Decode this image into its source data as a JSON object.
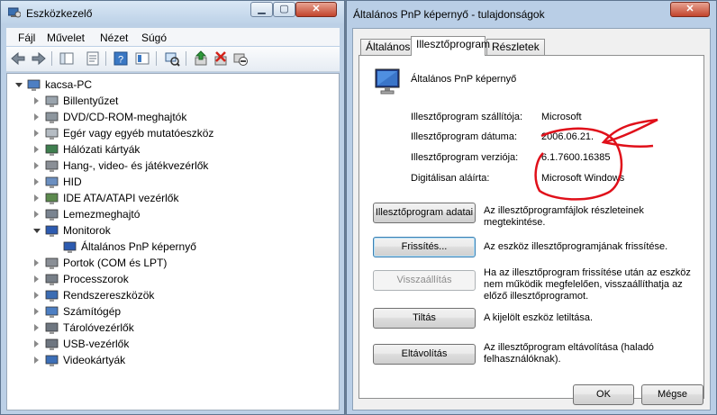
{
  "device_manager": {
    "title": "Eszközkezelő",
    "menu": [
      "Fájl",
      "Művelet",
      "Nézet",
      "Súgó"
    ],
    "toolbar_icons": [
      "back-arrow-icon",
      "forward-arrow-icon",
      "show-hide-console-tree-icon",
      "properties-icon",
      "help-icon",
      "view-icon",
      "scan-hardware-changes-icon",
      "update-driver-icon",
      "uninstall-icon",
      "disable-icon"
    ],
    "tree": [
      {
        "label": "kacsa-PC",
        "level": 0,
        "icon": "computer-icon",
        "expanded": true
      },
      {
        "label": "Billentyűzet",
        "level": 1,
        "icon": "keyboard-icon"
      },
      {
        "label": "DVD/CD-ROM-meghajtók",
        "level": 1,
        "icon": "dvd-drive-icon"
      },
      {
        "label": "Egér vagy egyéb mutatóeszköz",
        "level": 1,
        "icon": "mouse-icon"
      },
      {
        "label": "Hálózati kártyák",
        "level": 1,
        "icon": "network-card-icon"
      },
      {
        "label": "Hang-, video- és játékvezérlők",
        "level": 1,
        "icon": "speaker-icon"
      },
      {
        "label": "HID",
        "level": 1,
        "icon": "hid-icon"
      },
      {
        "label": "IDE ATA/ATAPI vezérlők",
        "level": 1,
        "icon": "ide-controller-icon"
      },
      {
        "label": "Lemezmeghajtó",
        "level": 1,
        "icon": "disk-drive-icon"
      },
      {
        "label": "Monitorok",
        "level": 1,
        "icon": "monitor-icon",
        "expanded": true
      },
      {
        "label": "Általános PnP képernyő",
        "level": 2,
        "icon": "monitor-icon"
      },
      {
        "label": "Portok (COM és LPT)",
        "level": 1,
        "icon": "port-icon"
      },
      {
        "label": "Processzorok",
        "level": 1,
        "icon": "processor-icon"
      },
      {
        "label": "Rendszereszközök",
        "level": 1,
        "icon": "system-device-icon"
      },
      {
        "label": "Számítógép",
        "level": 1,
        "icon": "computer-icon"
      },
      {
        "label": "Tárolóvezérlők",
        "level": 1,
        "icon": "storage-controller-icon"
      },
      {
        "label": "USB-vezérlők",
        "level": 1,
        "icon": "usb-icon"
      },
      {
        "label": "Videokártyák",
        "level": 1,
        "icon": "video-card-icon"
      }
    ]
  },
  "properties": {
    "title": "Általános PnP képernyő - tulajdonságok",
    "tabs": [
      "Általános",
      "Illesztőprogram",
      "Részletek"
    ],
    "active_tab": "Illesztőprogram",
    "device_name": "Általános PnP képernyő",
    "fields": [
      {
        "label": "Illesztőprogram szállítója:",
        "value": "Microsoft"
      },
      {
        "label": "Illesztőprogram dátuma:",
        "value": "2006.06.21."
      },
      {
        "label": "Illesztőprogram verziója:",
        "value": "6.1.7600.16385"
      },
      {
        "label": "Digitálisan aláírta:",
        "value": "Microsoft Windows"
      }
    ],
    "actions": [
      {
        "button": "Illesztőprogram adatai",
        "description": "Az illesztőprogramfájlok részleteinek megtekintése.",
        "enabled": true
      },
      {
        "button": "Frissítés...",
        "description": "Az eszköz illesztőprogramjának frissítése.",
        "enabled": true
      },
      {
        "button": "Visszaállítás",
        "description": "Ha az illesztőprogram frissítése után az eszköz nem működik megfelelően, visszaállíthatja az előző illesztőprogramot.",
        "enabled": false
      },
      {
        "button": "Tiltás",
        "description": "A kijelölt eszköz letiltása.",
        "enabled": true
      },
      {
        "button": "Eltávolítás",
        "description": "Az illesztőprogram eltávolítása (haladó felhasználóknak).",
        "enabled": true
      }
    ],
    "ok_label": "OK",
    "cancel_label": "Mégse",
    "annotation_color": "#e0101a"
  }
}
